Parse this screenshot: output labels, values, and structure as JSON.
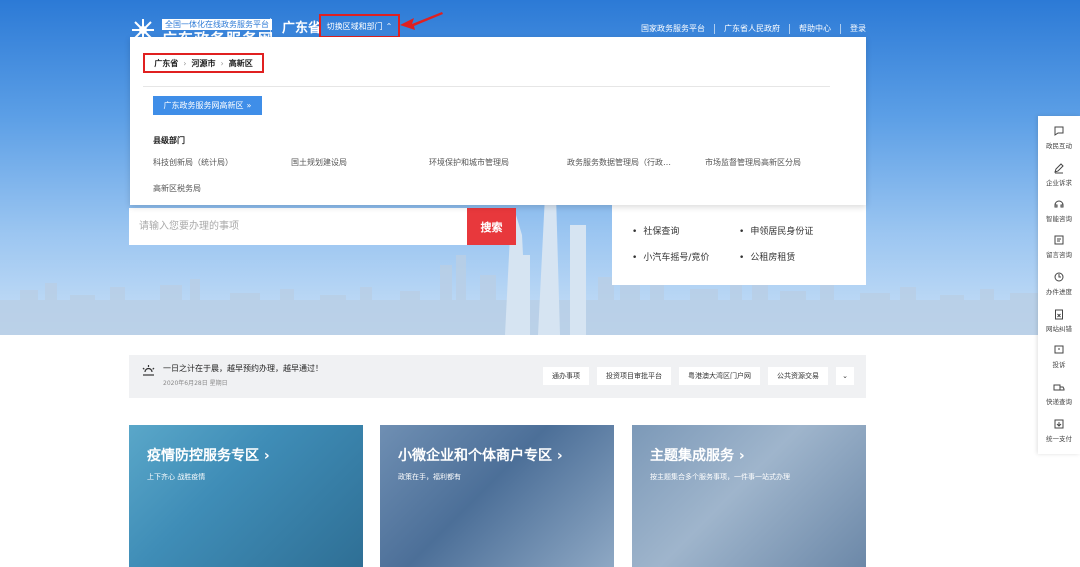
{
  "header": {
    "logo_sub": "全国一体化在线政务服务平台",
    "logo_main": "广东政务服务网",
    "province": "广东省",
    "switch_label": "切换区域和部门",
    "links": [
      "国家政务服务平台",
      "广东省人民政府",
      "帮助中心",
      "登录"
    ]
  },
  "dropdown": {
    "breadcrumb": [
      "广东省",
      "河源市",
      "高新区"
    ],
    "zone_button": "广东政务服务网高新区",
    "dept_title": "县级部门",
    "departments": [
      "科技创新局（统计局）",
      "国土规划建设局",
      "环境保护和城市管理局",
      "政务服务数据管理局（行政…",
      "市场监督管理局高新区分局",
      "高新区税务局"
    ]
  },
  "search": {
    "placeholder": "请输入您要办理的事项",
    "button": "搜索"
  },
  "hot_services": {
    "partial_top": [
      "…"
    ],
    "items": [
      "社保查询",
      "申领居民身份证",
      "小汽车摇号/竞价",
      "公租房租赁"
    ]
  },
  "notice": {
    "text": "一日之计在于晨，越早预约办理，越早通过！",
    "date": "2020年6月28日 星期日",
    "buttons": [
      "通办事项",
      "投资项目审批平台",
      "粤港澳大湾区门户网",
      "公共资源交易"
    ]
  },
  "features": [
    {
      "title": "疫情防控服务专区",
      "subtitle": "上下齐心 战胜疫情"
    },
    {
      "title": "小微企业和个体商户专区",
      "subtitle": "政策在手，福利都有"
    },
    {
      "title": "主题集成服务",
      "subtitle": "按主题集合多个服务事项，一件事一站式办理"
    }
  ],
  "sidebar": [
    {
      "label": "政民互动",
      "icon": "chat-icon"
    },
    {
      "label": "企业诉求",
      "icon": "pen-icon"
    },
    {
      "label": "智能咨询",
      "icon": "headset-icon"
    },
    {
      "label": "留言咨询",
      "icon": "message-icon"
    },
    {
      "label": "办件进度",
      "icon": "progress-icon"
    },
    {
      "label": "网站纠错",
      "icon": "clipboard-icon"
    },
    {
      "label": "投诉",
      "icon": "complaint-icon"
    },
    {
      "label": "快递查询",
      "icon": "truck-icon"
    },
    {
      "label": "统一支付",
      "icon": "pay-icon"
    }
  ],
  "colors": {
    "brand_blue": "#2c7ad6",
    "zone_button": "#3f8ee8",
    "search_red": "#e8383c",
    "highlight_red": "#e02020"
  }
}
